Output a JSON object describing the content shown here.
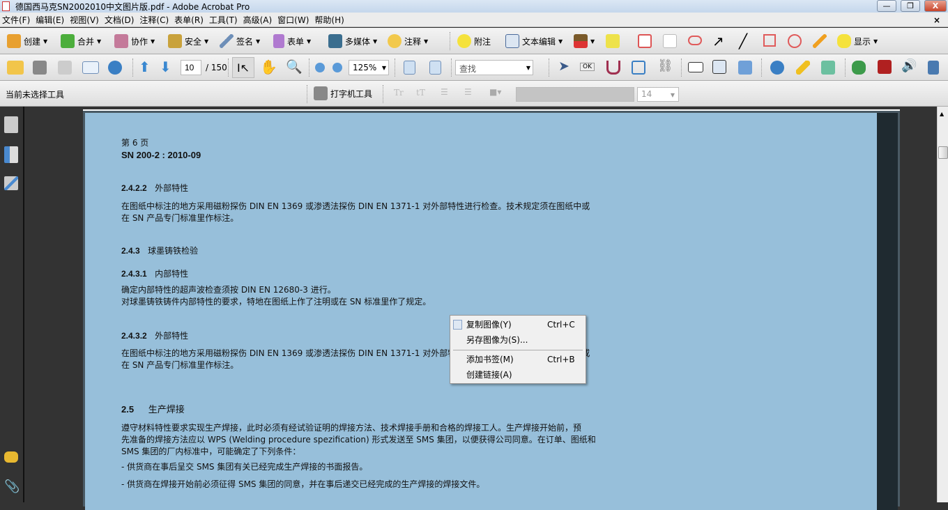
{
  "window": {
    "title": "德国西马克SN2002010中文图片版.pdf - Adobe Acrobat Pro",
    "minimize": "—",
    "restore": "❐",
    "close": "X"
  },
  "menu": [
    "文件(F)",
    "编辑(E)",
    "视图(V)",
    "文档(D)",
    "注释(C)",
    "表单(R)",
    "工具(T)",
    "高级(A)",
    "窗口(W)",
    "帮助(H)"
  ],
  "menu_close": "×",
  "toolbar1": {
    "create": "创建",
    "combine": "合并",
    "collaborate": "协作",
    "secure": "安全",
    "sign": "签名",
    "forms": "表单",
    "multimedia": "多媒体",
    "comment": "注释",
    "sticky_note": "附注",
    "text_edit": "文本编辑",
    "show": "显示"
  },
  "toolbar2": {
    "page_current": "10",
    "page_total": "/ 150",
    "zoom": "125%",
    "search_placeholder": "查找"
  },
  "toolbar3": {
    "status": "当前未选择工具",
    "typewriter": "打字机工具",
    "font_size": "14"
  },
  "document": {
    "page_label": "第 6 页",
    "doc_id": "SN 200-2 : 2010-09",
    "sections": [
      {
        "num": "2.4.2.2",
        "title": "外部特性",
        "lines": [
          "在图纸中标注的地方采用磁粉探伤 DIN EN 1369 或渗透法探伤 DIN EN 1371-1 对外部特性进行检查。技术规定须在图纸中或",
          "在 SN 产品专门标准里作标注。"
        ]
      },
      {
        "num": "2.4.3",
        "title": "球墨铸铁检验",
        "lines": []
      },
      {
        "num": "2.4.3.1",
        "title": "内部特性",
        "lines": [
          "确定内部特性的超声波检查须按 DIN EN 12680-3 进行。",
          "对球墨铸铁铸件内部特性的要求，特地在图纸上作了注明或在 SN 标准里作了规定。"
        ]
      },
      {
        "num": "2.4.3.2",
        "title": "外部特性",
        "lines": [
          "在图纸中标注的地方采用磁粉探伤 DIN EN 1369 或渗透法探伤 DIN EN 1371-1 对外部特性进行检查。技术规定须在图纸中或",
          "在 SN 产品专门标准里作标注。"
        ]
      },
      {
        "num": "2.5",
        "title": "生产焊接",
        "lines": [
          "遵守材料特性要求实现生产焊接，此时必须有经试验证明的焊接方法、技术焊接手册和合格的焊接工人。生产焊接开始前，预",
          "先准备的焊接方法应以 WPS (Welding procedure spezification) 形式发送至 SMS 集团，以便获得公司同意。在订单、图纸和",
          "SMS 集团的厂内标准中，可能确定了下列条件："
        ]
      }
    ],
    "bullets": [
      "- 供货商在事后呈交 SMS 集团有关已经完成生产焊接的书面报告。",
      "- 供货商在焊接开始前必须征得 SMS 集团的同意，并在事后递交已经完成的生产焊接的焊接文件。"
    ]
  },
  "context_menu": [
    {
      "label": "复制图像(Y)",
      "shortcut": "Ctrl+C"
    },
    {
      "label": "另存图像为(S)...",
      "shortcut": ""
    },
    {
      "label": "添加书签(M)",
      "shortcut": "Ctrl+B"
    },
    {
      "label": "创建链接(A)",
      "shortcut": ""
    }
  ]
}
